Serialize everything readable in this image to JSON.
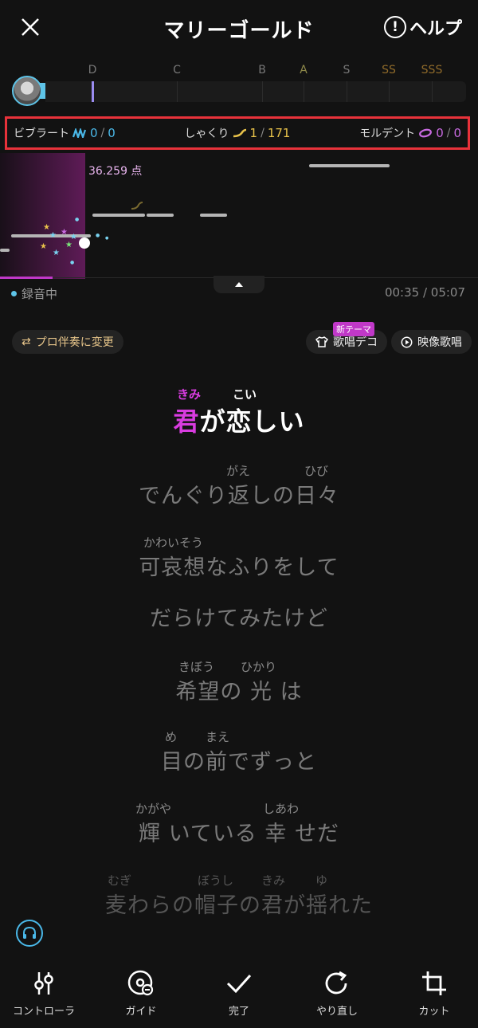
{
  "header": {
    "title": "マリーゴールド",
    "help_label": "ヘルプ"
  },
  "grades": [
    "D",
    "C",
    "B",
    "A",
    "S",
    "SS",
    "SSS"
  ],
  "stats": {
    "vibrato": {
      "label": "ビブラート",
      "value": "0",
      "total": "0"
    },
    "shakuri": {
      "label": "しゃくり",
      "value": "1",
      "total": "171"
    },
    "mordent": {
      "label": "モルデント",
      "value": "0",
      "total": "0"
    }
  },
  "pitch": {
    "score": "36.259 点"
  },
  "recording": {
    "status": "録音中",
    "time": "00:35 / 05:07"
  },
  "chips": {
    "pro_label": "プロ伴奏に変更",
    "deco_label": "歌唱デコ",
    "deco_badge": "新テーマ",
    "video_label": "映像歌唱"
  },
  "lyrics": {
    "current": {
      "ruby1": "きみ",
      "ruby2": "こい",
      "hl": "君",
      "rest": "が恋しい"
    },
    "l1": {
      "ruby1": "がえ",
      "ruby2": "ひび",
      "text": "でんぐり返しの日々"
    },
    "l2": {
      "ruby1": "かわいそう",
      "text": "可哀想なふりをして"
    },
    "l3": {
      "text": "だらけてみたけど"
    },
    "l4": {
      "ruby1": "きぼう",
      "ruby2": "ひかり",
      "text": "希望の 光 は"
    },
    "l5": {
      "ruby1": "め",
      "ruby2": "まえ",
      "text": "目の前でずっと"
    },
    "l6": {
      "ruby1": "かがや",
      "ruby2": "しあわ",
      "text": "輝 いている 幸 せだ"
    },
    "l7": {
      "ruby1": "むぎ",
      "ruby2": "ぼうし",
      "ruby3": "きみ",
      "ruby4": "ゆ",
      "text": "麦わらの帽子の君が揺れた"
    }
  },
  "toolbar": {
    "controller": "コントローラ",
    "guide": "ガイド",
    "done": "完了",
    "redo": "やり直し",
    "cut": "カット"
  },
  "colors": {
    "accent": "#d93ce0",
    "cyan": "#4ab8e8",
    "gold": "#e8c24a",
    "highlight_border": "#e8323a"
  }
}
